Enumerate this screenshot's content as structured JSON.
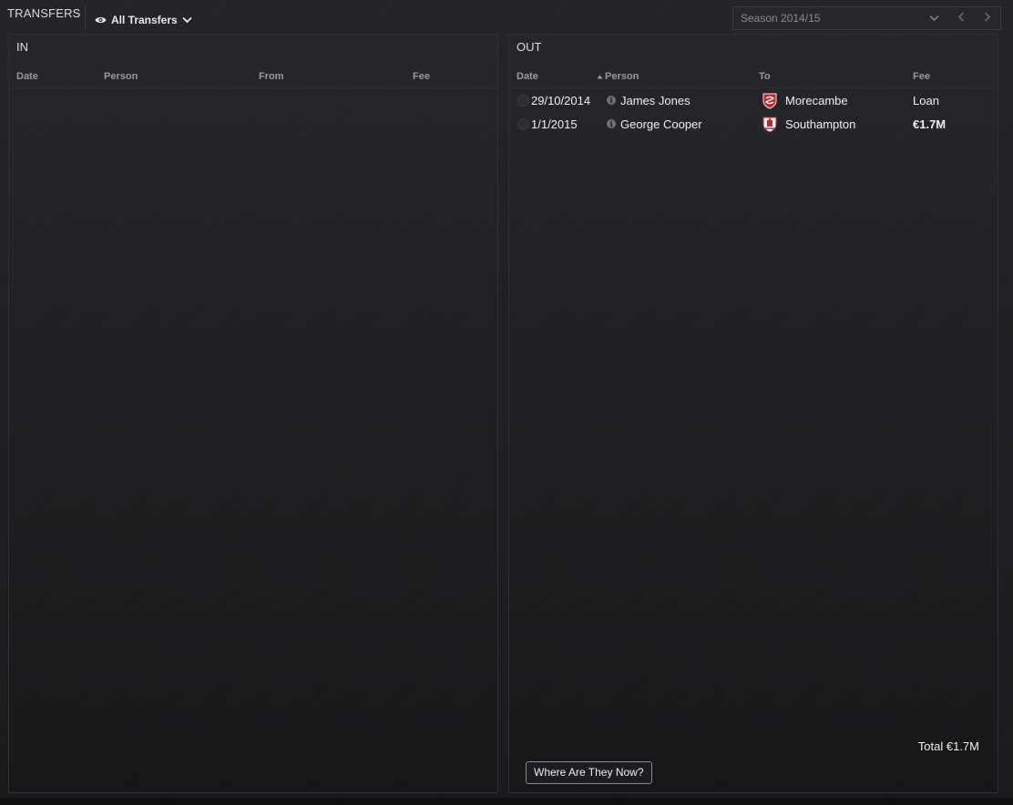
{
  "header": {
    "title": "TRANSFERS",
    "filter_label": "All Transfers",
    "season_label": "Season 2014/15"
  },
  "in_panel": {
    "title": "IN",
    "columns": [
      "Date",
      "Person",
      "From",
      "Fee"
    ]
  },
  "out_panel": {
    "title": "OUT",
    "columns": [
      "Date",
      "Person",
      "To",
      "Fee"
    ],
    "rows": [
      {
        "date": "29/10/2014",
        "person": "James Jones",
        "club": "Morecambe",
        "fee": "Loan"
      },
      {
        "date": "1/1/2015",
        "person": "George Cooper",
        "club": "Southampton",
        "fee": "€1.7M"
      }
    ],
    "total_label": "Total",
    "total_value": "€1.7M",
    "where_button": "Where Are They Now?"
  },
  "icons": {
    "filter": "eye-icon",
    "dropdown": "chevron-down-icon",
    "prev": "chevron-left-icon",
    "next": "chevron-right-icon",
    "info": "info-icon",
    "clock": "clock-icon",
    "crest_morecambe": "club-crest-icon",
    "crest_southampton": "club-crest-icon"
  },
  "colors": {
    "background": "#1c1d20",
    "text": "#f0f0f0",
    "muted": "#9a9b9f",
    "crest_red": "#c8232c"
  }
}
